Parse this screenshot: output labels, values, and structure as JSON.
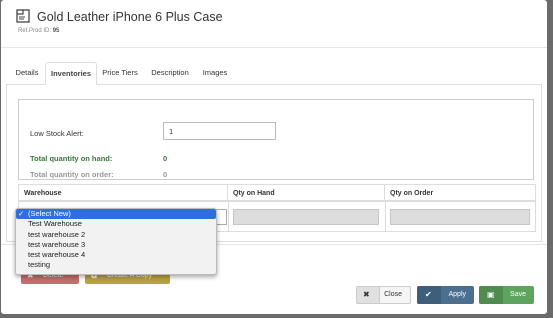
{
  "header": {
    "title": "Gold Leather iPhone 6 Plus Case",
    "ref_label": "Ref.Prod ID:",
    "ref_value": "95"
  },
  "tabs": [
    {
      "label": "Details"
    },
    {
      "label": "Inventories",
      "active": true
    },
    {
      "label": "Price Tiers"
    },
    {
      "label": "Description"
    },
    {
      "label": "Images"
    }
  ],
  "inventory": {
    "low_stock_label": "Low Stock Alert:",
    "low_stock_value": "1",
    "on_hand_label": "Total quantity on hand:",
    "on_hand_value": "0",
    "on_order_label": "Total quantity on order:",
    "on_order_value": "0"
  },
  "warehouse_table": {
    "columns": [
      "Warehouse",
      "Qty on Hand",
      "Qty on Order"
    ]
  },
  "dropdown": {
    "options": [
      "(Select New)",
      "Test Warehouse",
      "test warehouse 2",
      "test warehouse 3",
      "test warehouse 4",
      "testing"
    ],
    "selected_index": 0,
    "check_glyph": "✓"
  },
  "buttons": {
    "delete": "Delete",
    "copy": "Create A Copy",
    "close": "Close",
    "apply": "Apply",
    "save": "Save"
  },
  "colors": {
    "success_text": "#3c763d",
    "selected_option": "#2e6fdb",
    "apply_button": "#4a6f8f",
    "save_button": "#5ea45e",
    "delete_button": "#b94a48",
    "copy_button": "#a88b12"
  }
}
